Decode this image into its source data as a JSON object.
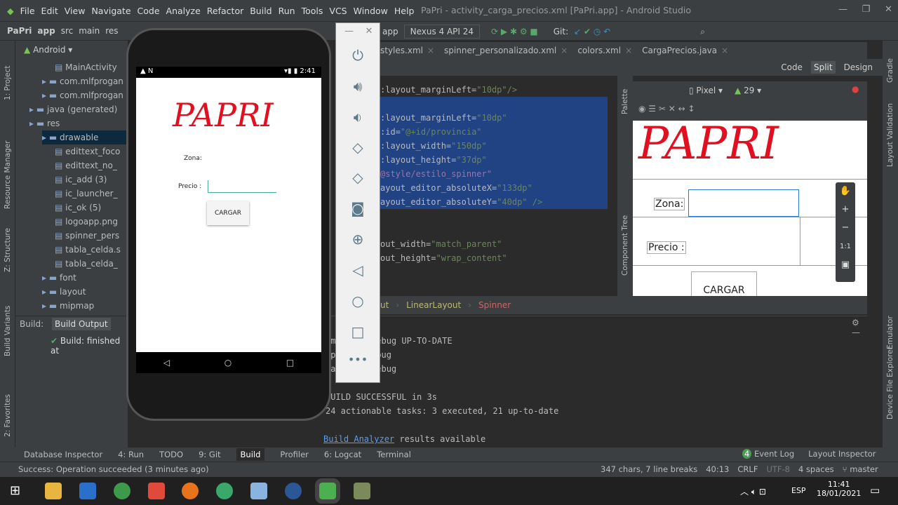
{
  "menu": [
    "File",
    "Edit",
    "View",
    "Navigate",
    "Code",
    "Analyze",
    "Refactor",
    "Build",
    "Run",
    "Tools",
    "VCS",
    "Window",
    "Help"
  ],
  "window_title": "PaPri - activity_carga_precios.xml [PaPri.app] - Android Studio",
  "breadcrumb": [
    "PaPri",
    "app",
    "src",
    "main",
    "res"
  ],
  "run_config": "app",
  "device": "Nexus 4 API 24",
  "git_label": "Git:",
  "left_tools": [
    "1: Project",
    "Resource Manager",
    "Z: Structure",
    "Build Variants",
    "2: Favorites"
  ],
  "right_tools": [
    "Gradle",
    "Layout Validation",
    "Emulator",
    "Device File Explorer"
  ],
  "project": {
    "view": "Android",
    "items": [
      {
        "label": "MainActivity",
        "indent": 4
      },
      {
        "label": "com.mlfprogan",
        "indent": 3
      },
      {
        "label": "com.mlfprogan",
        "indent": 3
      },
      {
        "label": "java (generated)",
        "indent": 2
      },
      {
        "label": "res",
        "indent": 2
      },
      {
        "label": "drawable",
        "indent": 3,
        "selected": true
      },
      {
        "label": "edittext_foco",
        "indent": 4
      },
      {
        "label": "edittext_no_",
        "indent": 4
      },
      {
        "label": "ic_add (3)",
        "indent": 4
      },
      {
        "label": "ic_launcher_",
        "indent": 4
      },
      {
        "label": "ic_ok (5)",
        "indent": 4
      },
      {
        "label": "logoapp.png",
        "indent": 4
      },
      {
        "label": "spinner_pers",
        "indent": 4
      },
      {
        "label": "tabla_celda.s",
        "indent": 4
      },
      {
        "label": "tabla_celda_",
        "indent": 4
      },
      {
        "label": "font",
        "indent": 3
      },
      {
        "label": "layout",
        "indent": 3
      },
      {
        "label": "mipmap",
        "indent": 3
      }
    ]
  },
  "phone": {
    "time": "2:41",
    "title": "PAPRI",
    "zona_label": "Zona:",
    "precio_label": "Precio :",
    "button": "CARGAR"
  },
  "editor_tabs": [
    "styles.xml",
    "spinner_personalizado.xml",
    "colors.xml",
    "CargaPrecios.java"
  ],
  "view_modes": [
    "Code",
    "Split",
    "Design"
  ],
  "code_lines": [
    {
      "a": ":layout_marginLeft",
      "v": "\"10dp\"/>",
      "sel": false
    },
    {
      "a": "",
      "v": "",
      "sel": true
    },
    {
      "a": ":layout_marginLeft",
      "v": "\"10dp\"",
      "sel": true
    },
    {
      "a": ":id",
      "v": "\"@+id/provincia\"",
      "sel": true
    },
    {
      "a": ":layout_width",
      "v": "\"150dp\"",
      "sel": true
    },
    {
      "a": ":layout_height",
      "v": "\"37dp\"",
      "sel": true
    },
    {
      "a": "",
      "v": "@style/estilo_spinner\"",
      "sel": true
    },
    {
      "a": "ayout_editor_absoluteX",
      "v": "\"133dp\"",
      "sel": true
    },
    {
      "a": "ayout_editor_absoluteY",
      "v": "\"40dp\" />",
      "sel": true
    },
    {
      "a": "",
      "v": "",
      "sel": false
    },
    {
      "a": "",
      "v": "",
      "sel": false
    },
    {
      "a": "out_width",
      "v": "\"match_parent\"",
      "sel": false
    },
    {
      "a": "out_height",
      "v": "\"wrap_content\"",
      "sel": false
    }
  ],
  "code_breadcrumb": [
    "ut",
    "LinearLayout",
    "Spinner"
  ],
  "design": {
    "device": "Pixel",
    "api": "29",
    "title": "PAPRI",
    "zona": "Zona:",
    "precio": "Precio :",
    "button": "CARGAR",
    "zoom_fit": "1:1"
  },
  "build": {
    "tab_label": "Build:",
    "tab": "Build Output",
    "tree": "Build: finished at",
    "lines": [
      ":mergeDexDebug UP-TO-DATE",
      ":packageDebug",
      ":assembleDebug",
      "",
      "BUILD SUCCESSFUL in 3s",
      "24 actionable tasks: 3 executed, 21 up-to-date",
      ""
    ],
    "link": "Build Analyzer",
    "link_suffix": " results available"
  },
  "bottom_tools": [
    "Database Inspector",
    "4: Run",
    "TODO",
    "9: Git",
    "Build",
    "Profiler",
    "6: Logcat",
    "Terminal"
  ],
  "bottom_right": [
    "Event Log",
    "Layout Inspector"
  ],
  "status": {
    "message": "Success: Operation succeeded (3 minutes ago)",
    "chars": "347 chars, 7 line breaks",
    "pos": "40:13",
    "eol": "CRLF",
    "enc": "UTF-8",
    "indent": "4 spaces",
    "branch": "master"
  },
  "taskbar": {
    "lang": "ESP",
    "time": "11:41",
    "date": "18/01/2021"
  },
  "colors": {
    "accent": "#214283",
    "papri_red": "#e01020"
  }
}
